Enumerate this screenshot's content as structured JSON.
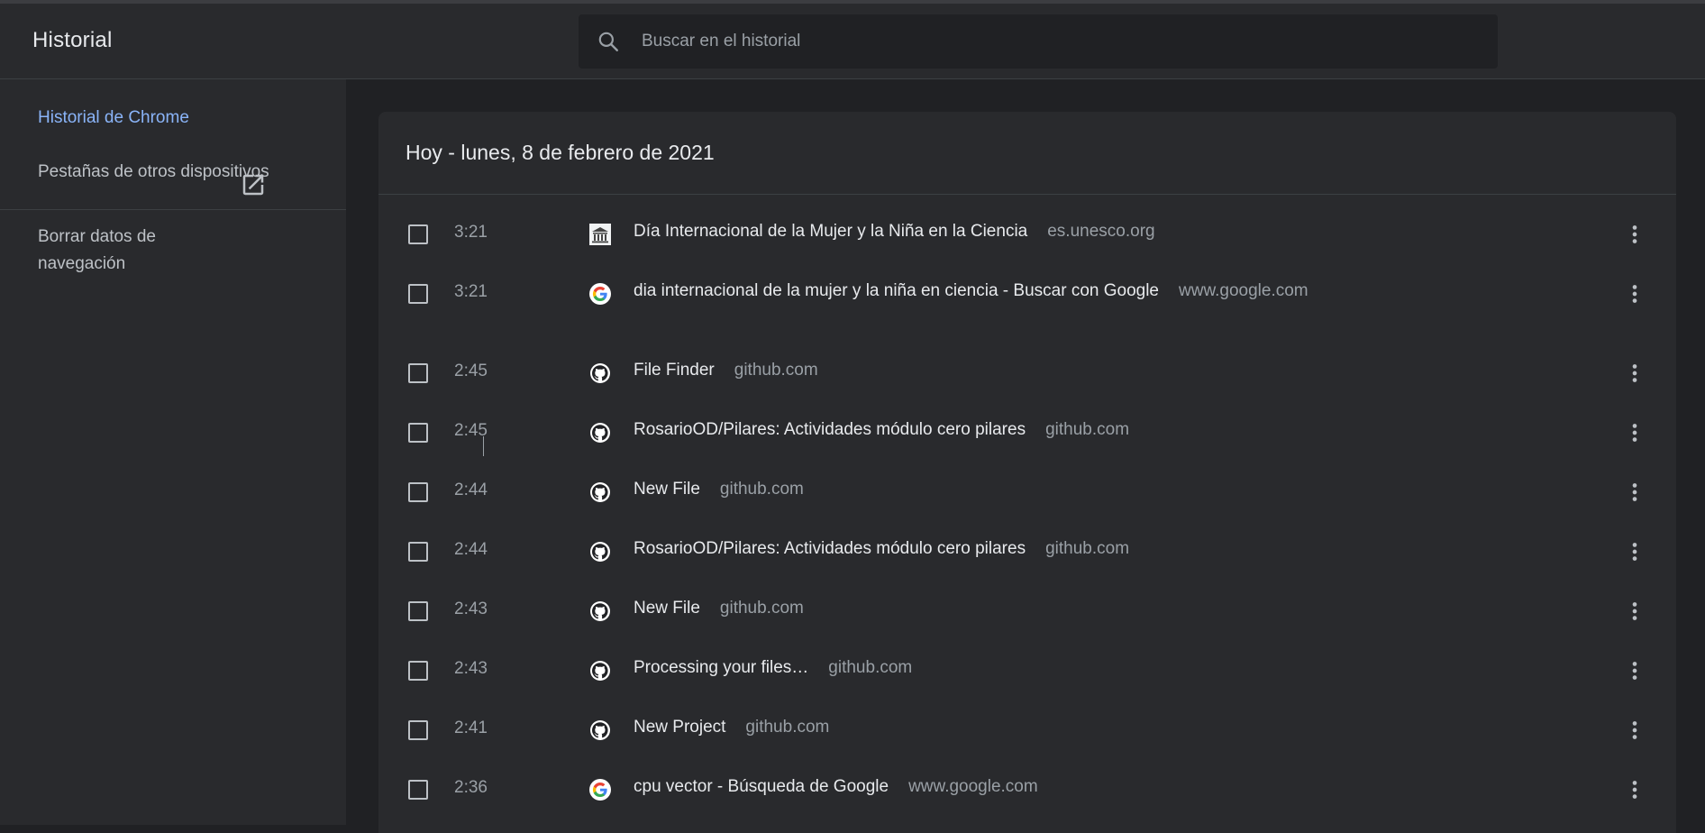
{
  "app": {
    "title": "Historial"
  },
  "search": {
    "placeholder": "Buscar en el historial",
    "value": ""
  },
  "sidebar": {
    "items": [
      {
        "label": "Historial de Chrome",
        "active": true
      },
      {
        "label": "Pestañas de otros dispositivos",
        "active": false
      }
    ],
    "clear_data_label": "Borrar datos de navegación"
  },
  "history": {
    "date_header": "Hoy - lunes, 8 de febrero de 2021",
    "entries": [
      {
        "time": "3:21",
        "title": "Día Internacional de la Mujer y la Niña en la Ciencia",
        "domain": "es.unesco.org",
        "icon": "unesco-icon"
      },
      {
        "time": "3:21",
        "title": "dia internacional de la mujer y la niña en ciencia - Buscar con Google",
        "domain": "www.google.com",
        "icon": "google-icon"
      },
      {
        "time": "2:45",
        "title": "File Finder",
        "domain": "github.com",
        "icon": "github-icon"
      },
      {
        "time": "2:45",
        "title": "RosarioOD/Pilares: Actividades módulo cero pilares",
        "domain": "github.com",
        "icon": "github-icon"
      },
      {
        "time": "2:44",
        "title": "New File",
        "domain": "github.com",
        "icon": "github-icon"
      },
      {
        "time": "2:44",
        "title": "RosarioOD/Pilares: Actividades módulo cero pilares",
        "domain": "github.com",
        "icon": "github-icon"
      },
      {
        "time": "2:43",
        "title": "New File",
        "domain": "github.com",
        "icon": "github-icon"
      },
      {
        "time": "2:43",
        "title": "Processing your files…",
        "domain": "github.com",
        "icon": "github-icon"
      },
      {
        "time": "2:41",
        "title": "New Project",
        "domain": "github.com",
        "icon": "github-icon"
      },
      {
        "time": "2:36",
        "title": "cpu vector - Búsqueda de Google",
        "domain": "www.google.com",
        "icon": "google-icon"
      }
    ]
  },
  "colors": {
    "accent": "#8ab4f8",
    "background": "#202124",
    "surface": "#292a2d"
  }
}
